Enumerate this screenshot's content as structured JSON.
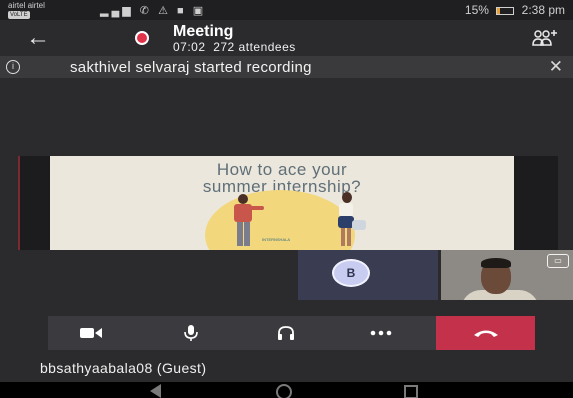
{
  "status_bar": {
    "carrier_line1": "airtel airtel",
    "volte_badge": "VoLTE",
    "battery_text": "15%",
    "battery_level": 0.15,
    "time": "2:38 pm"
  },
  "header": {
    "title": "Meeting",
    "duration": "07:02",
    "attendees": "272 attendees",
    "icons": {
      "back": "arrow-left-icon",
      "recording": "recording-dot-icon",
      "add_people": "add-people-icon"
    },
    "recording_color": "#e0334a"
  },
  "banner": {
    "text": "sakthivel selvaraj started recording",
    "icon": "info-icon",
    "close_icon": "close-icon"
  },
  "shared_slide": {
    "title_line1": "How to ace your",
    "title_line2": "summer internship?",
    "logo_text": "INTERNSHALA"
  },
  "participants": {
    "initial": "B",
    "avatar_color": "#c7ccf0"
  },
  "controls": {
    "video_icon": "camera-icon",
    "mic_icon": "microphone-icon",
    "speaker_icon": "headset-icon",
    "more_icon": "more-dots-icon",
    "hangup_icon": "hang-up-icon",
    "hangup_color": "#c4314b"
  },
  "caption": {
    "name": "bbsathyaabala08 (Guest)"
  }
}
